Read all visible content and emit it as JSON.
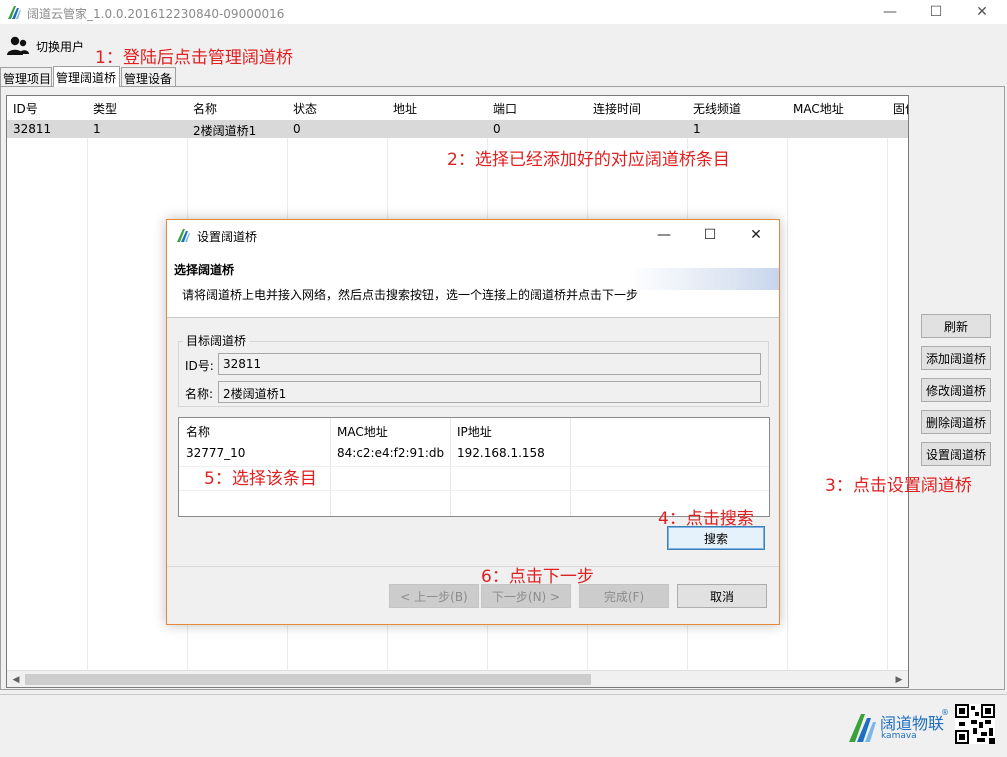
{
  "window": {
    "title": "阔道云管家_1.0.0.201612230840-09000016",
    "minimize": "—",
    "maximize": "☐",
    "close": "✕"
  },
  "toolbar": {
    "switch_user": "切换用户"
  },
  "tabs": [
    "管理项目",
    "管理阔道桥",
    "管理设备"
  ],
  "table": {
    "columns": [
      "ID号",
      "类型",
      "名称",
      "状态",
      "地址",
      "端口",
      "连接时间",
      "无线频道",
      "MAC地址",
      "固件"
    ],
    "rows": [
      [
        "32811",
        "1",
        "2楼阔道桥1",
        "0",
        "",
        "0",
        "",
        "1",
        "",
        ""
      ]
    ]
  },
  "side_buttons": [
    "刷新",
    "添加阔道桥",
    "修改阔道桥",
    "删除阔道桥",
    "设置阔道桥"
  ],
  "annotations": [
    "1：登陆后点击管理阔道桥",
    "2：选择已经添加好的对应阔道桥条目",
    "3：点击设置阔道桥",
    "4：点击搜索",
    "5：选择该条目",
    "6：点击下一步"
  ],
  "dialog": {
    "title": "设置阔道桥",
    "heading": "选择阔道桥",
    "description": "请将阔道桥上电并接入网络，然后点击搜索按钮，选一个连接上的阔道桥并点击下一步",
    "group_label": "目标阔道桥",
    "id_label": "ID号:",
    "id_value": "32811",
    "name_label": "名称:",
    "name_value": "2楼阔道桥1",
    "list_columns": [
      "名称",
      "MAC地址",
      "IP地址"
    ],
    "list_rows": [
      [
        "32777_10",
        "84:c2:e4:f2:91:db",
        "192.168.1.158"
      ]
    ],
    "search_label": "搜索",
    "prev_label": "< 上一步(B)",
    "next_label": "下一步(N) >",
    "finish_label": "完成(F)",
    "cancel_label": "取消"
  },
  "brand": {
    "name": "阔道物联",
    "tm": "®",
    "sub": "kamava"
  },
  "colors": {
    "annotation": "#e02020",
    "brand": "#1e6fbf",
    "dialog_border": "#e5893a",
    "selected_row": "#d9d9d9"
  },
  "icons": {
    "app": "kamava-logo-icon",
    "user": "users-icon",
    "qr": "qr-code-icon"
  }
}
